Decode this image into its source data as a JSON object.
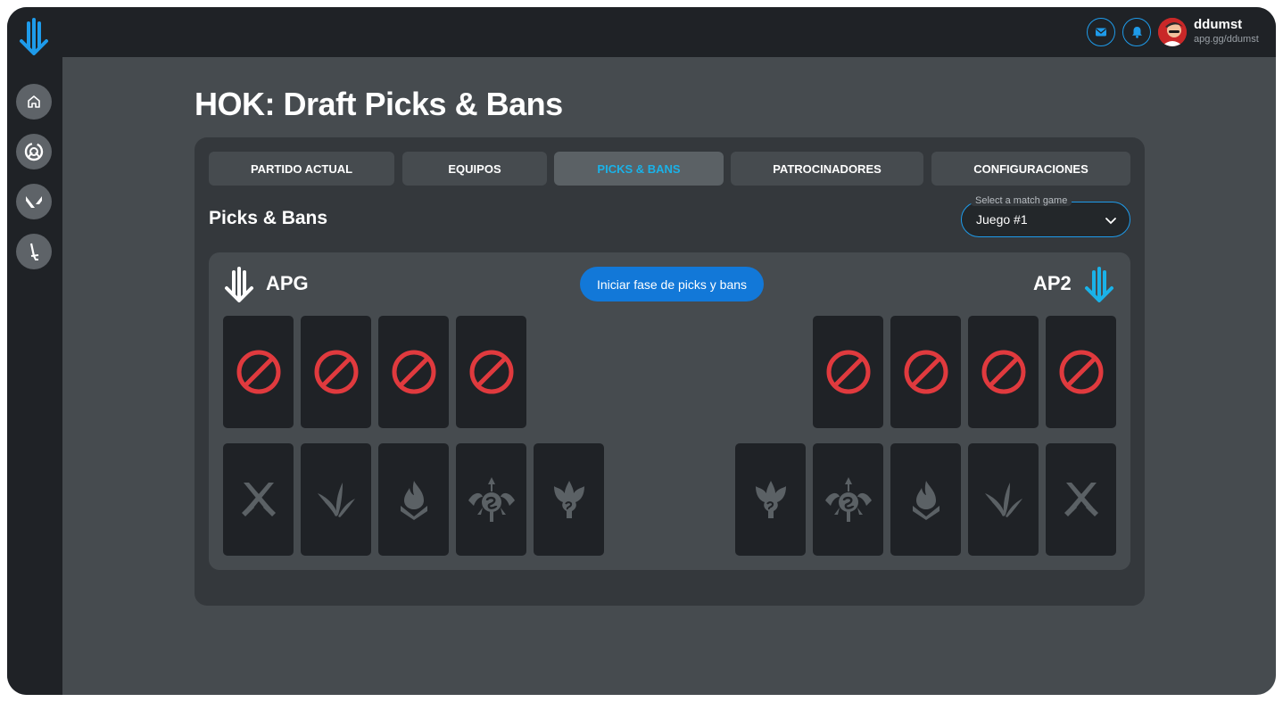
{
  "user": {
    "name": "ddumst",
    "handle": "apg.gg/ddumst"
  },
  "header": {
    "messages_icon": "envelope-icon",
    "notifications_icon": "bell-icon"
  },
  "sidebar": {
    "items": [
      {
        "icon": "home-icon"
      },
      {
        "icon": "overwatch-icon"
      },
      {
        "icon": "valorant-icon"
      },
      {
        "icon": "sword-icon"
      }
    ]
  },
  "page": {
    "title": "HOK: Draft Picks & Bans"
  },
  "tabs": [
    {
      "label": "PARTIDO ACTUAL",
      "active": false
    },
    {
      "label": "EQUIPOS",
      "active": false
    },
    {
      "label": "PICKS & BANS",
      "active": true
    },
    {
      "label": "PATROCINADORES",
      "active": false
    },
    {
      "label": "CONFIGURACIONES",
      "active": false
    }
  ],
  "section": {
    "title": "Picks & Bans"
  },
  "game_select": {
    "legend": "Select a match game",
    "value": "Juego #1"
  },
  "draft": {
    "start_button": "Iniciar fase de picks y bans",
    "team_left": {
      "name": "APG",
      "logo_color": "#ffffff"
    },
    "team_right": {
      "name": "AP2",
      "logo_color": "#1ab2e8"
    },
    "ban_icon": "ban-icon",
    "left_picks": [
      "swords-icon",
      "leaves-icon",
      "flame-icon",
      "trident-icon",
      "dragon-icon"
    ],
    "right_picks": [
      "dragon-icon",
      "trident-icon",
      "flame-icon",
      "leaves-icon",
      "swords-icon"
    ]
  },
  "colors": {
    "accent": "#1e9bea",
    "ban": "#e03a3e",
    "active_tab_text": "#1ab2e8"
  }
}
